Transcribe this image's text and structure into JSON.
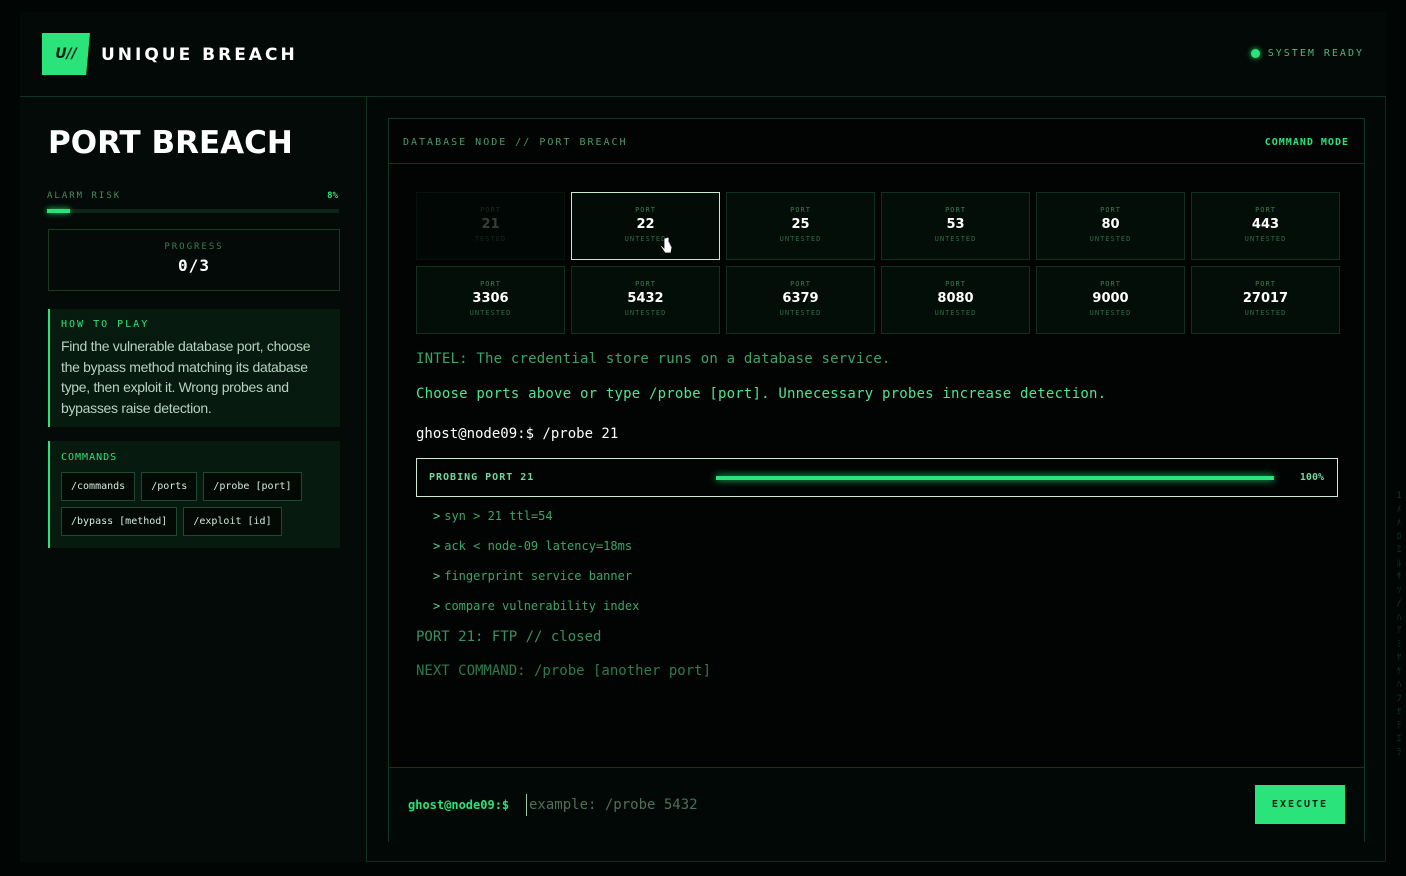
{
  "header": {
    "logo_text": "U//",
    "brand": "UNIQUE BREACH",
    "status": "SYSTEM READY"
  },
  "sidebar": {
    "title": "PORT BREACH",
    "alarm": {
      "label": "ALARM RISK",
      "value_text": "8%",
      "fraction": 0.08
    },
    "progress": {
      "label": "PROGRESS",
      "value": "0/3"
    },
    "how_to": {
      "title": "HOW TO PLAY",
      "text": "Find the vulnerable database port, choose the bypass method matching its database type, then exploit it. Wrong probes and bypasses raise detection."
    },
    "commands": {
      "title": "COMMANDS",
      "items": [
        "/commands",
        "/ports",
        "/probe [port]",
        "/bypass [method]",
        "/exploit [id]"
      ]
    }
  },
  "panel": {
    "breadcrumb": "DATABASE NODE // PORT BREACH",
    "mode": "COMMAND MODE",
    "port_label": "PORT",
    "ports": [
      {
        "number": "21",
        "status": "TESTED",
        "state": "tested"
      },
      {
        "number": "22",
        "status": "UNTESTED",
        "state": "selected"
      },
      {
        "number": "25",
        "status": "UNTESTED",
        "state": "untested"
      },
      {
        "number": "53",
        "status": "UNTESTED",
        "state": "untested"
      },
      {
        "number": "80",
        "status": "UNTESTED",
        "state": "untested"
      },
      {
        "number": "443",
        "status": "UNTESTED",
        "state": "untested"
      },
      {
        "number": "3306",
        "status": "UNTESTED",
        "state": "untested"
      },
      {
        "number": "5432",
        "status": "UNTESTED",
        "state": "untested"
      },
      {
        "number": "6379",
        "status": "UNTESTED",
        "state": "untested"
      },
      {
        "number": "8080",
        "status": "UNTESTED",
        "state": "untested"
      },
      {
        "number": "9000",
        "status": "UNTESTED",
        "state": "untested"
      },
      {
        "number": "27017",
        "status": "UNTESTED",
        "state": "untested"
      }
    ],
    "intel": "INTEL: The credential store runs on a database service.",
    "instruction": "Choose ports above or type /probe [port]. Unnecessary probes increase detection.",
    "prompt_line": "ghost@node09:$ /probe 21",
    "probe": {
      "label": "PROBING PORT 21",
      "percent_text": "100%",
      "fraction": 1.0
    },
    "log": [
      "syn > 21 ttl=54",
      "ack < node-09 latency=18ms",
      "fingerprint service banner",
      "compare vulnerability index"
    ],
    "result": "PORT 21: FTP // closed",
    "next": "NEXT COMMAND: /probe [another port]",
    "input": {
      "prompt": "ghost@node09:$",
      "placeholder": "example: /probe 5432",
      "value": ""
    },
    "execute_label": "EXECUTE"
  },
  "colors": {
    "accent": "#2ae37a",
    "background": "#010504",
    "border": "#123321"
  }
}
